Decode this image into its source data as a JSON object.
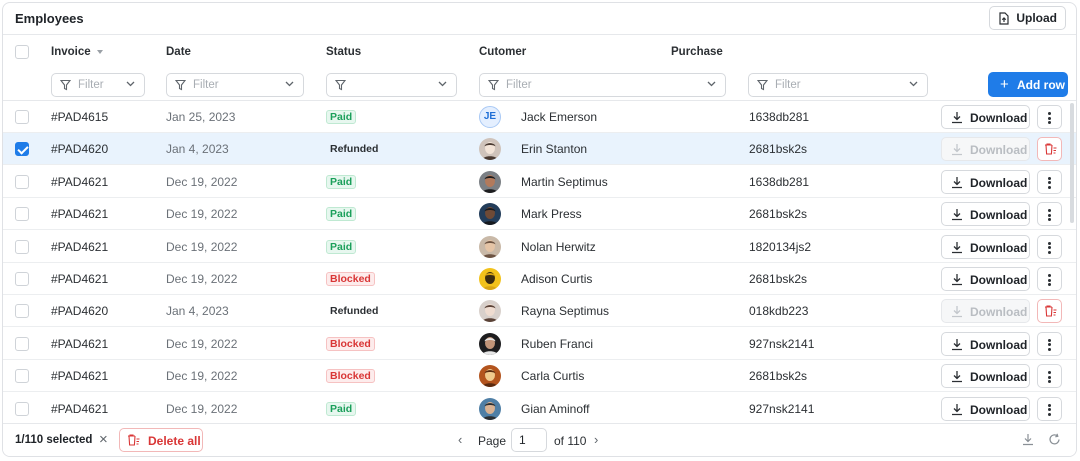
{
  "header": {
    "title": "Employees",
    "upload_label": "Upload"
  },
  "columns": {
    "invoice": "Invoice",
    "date": "Date",
    "status": "Status",
    "customer": "Cutomer",
    "purchase": "Purchase"
  },
  "filters": {
    "invoice_placeholder": "Filter",
    "date_placeholder": "Filter",
    "status_placeholder": "",
    "customer_placeholder": "Filter",
    "purchase_placeholder": "Filter"
  },
  "add_row_label": "Add row",
  "download_label": "Download",
  "rows": [
    {
      "invoice": "#PAD4615",
      "date": "Jan 25, 2023",
      "status": "Paid",
      "status_kind": "paid",
      "customer": "Jack Emerson",
      "avatar_initials": "JE",
      "purchase": "1638db281",
      "selected": false
    },
    {
      "invoice": "#PAD4620",
      "date": "Jan 4, 2023",
      "status": "Refunded",
      "status_kind": "refunded",
      "customer": "Erin Stanton",
      "avatar_initials": "",
      "purchase": "2681bsk2s",
      "selected": true
    },
    {
      "invoice": "#PAD4621",
      "date": "Dec 19, 2022",
      "status": "Paid",
      "status_kind": "paid",
      "customer": "Martin Septimus",
      "avatar_initials": "",
      "purchase": "1638db281",
      "selected": false
    },
    {
      "invoice": "#PAD4621",
      "date": "Dec 19, 2022",
      "status": "Paid",
      "status_kind": "paid",
      "customer": "Mark Press",
      "avatar_initials": "",
      "purchase": "2681bsk2s",
      "selected": false
    },
    {
      "invoice": "#PAD4621",
      "date": "Dec 19, 2022",
      "status": "Paid",
      "status_kind": "paid",
      "customer": "Nolan Herwitz",
      "avatar_initials": "",
      "purchase": "1820134js2",
      "selected": false
    },
    {
      "invoice": "#PAD4621",
      "date": "Dec 19, 2022",
      "status": "Blocked",
      "status_kind": "blocked",
      "customer": "Adison Curtis",
      "avatar_initials": "",
      "purchase": "2681bsk2s",
      "selected": false
    },
    {
      "invoice": "#PAD4620",
      "date": "Jan 4, 2023",
      "status": "Refunded",
      "status_kind": "refunded",
      "customer": "Rayna Septimus",
      "avatar_initials": "",
      "purchase": "018kdb223",
      "selected": false
    },
    {
      "invoice": "#PAD4621",
      "date": "Dec 19, 2022",
      "status": "Blocked",
      "status_kind": "blocked",
      "customer": "Ruben Franci",
      "avatar_initials": "",
      "purchase": "927nsk2141",
      "selected": false
    },
    {
      "invoice": "#PAD4621",
      "date": "Dec 19, 2022",
      "status": "Blocked",
      "status_kind": "blocked",
      "customer": "Carla Curtis",
      "avatar_initials": "",
      "purchase": "2681bsk2s",
      "selected": false
    },
    {
      "invoice": "#PAD4621",
      "date": "Dec 19, 2022",
      "status": "Paid",
      "status_kind": "paid",
      "customer": "Gian Aminoff",
      "avatar_initials": "",
      "purchase": "927nsk2141",
      "selected": false
    }
  ],
  "footer": {
    "selected_text": "1/110 selected",
    "delete_all_label": "Delete all",
    "page_label": "Page",
    "page_value": "1",
    "page_of": "of 110"
  },
  "colors": {
    "accent": "#1f7ce8",
    "paid": "#1a9f5a",
    "blocked": "#d93636",
    "selected_row": "#e9f3fd"
  }
}
